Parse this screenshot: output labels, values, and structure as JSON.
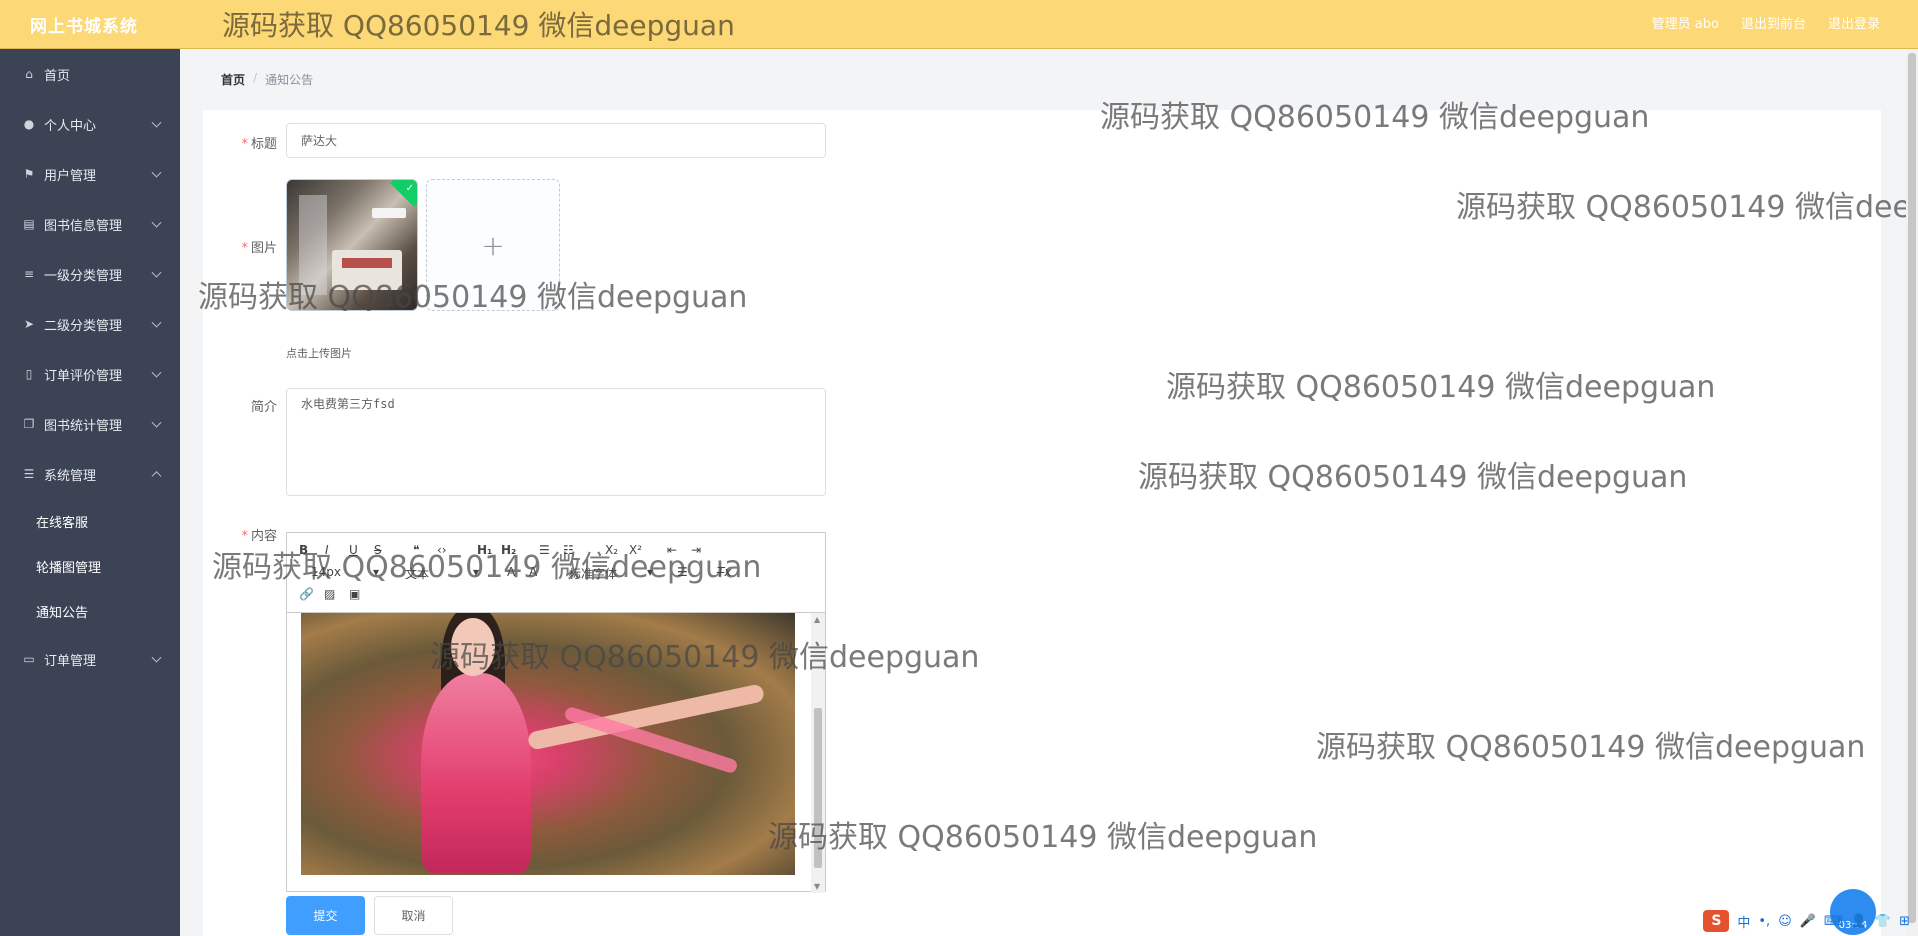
{
  "header": {
    "logo": "网上书城系统",
    "watermark": "源码获取 QQ86050149 微信deepguan",
    "admin_label": "管理员 abo",
    "back_label": "退出到前台",
    "logout_label": "退出登录"
  },
  "sidebar": {
    "items": [
      {
        "label": "首页",
        "icon": "home-icon"
      },
      {
        "label": "个人中心",
        "icon": "user-icon"
      },
      {
        "label": "用户管理",
        "icon": "flag-icon"
      },
      {
        "label": "图书信息管理",
        "icon": "book-icon"
      },
      {
        "label": "一级分类管理",
        "icon": "list-icon"
      },
      {
        "label": "二级分类管理",
        "icon": "send-icon"
      },
      {
        "label": "订单评价管理",
        "icon": "mobile-icon"
      },
      {
        "label": "图书统计管理",
        "icon": "copy-icon"
      },
      {
        "label": "系统管理",
        "icon": "sliders-icon"
      },
      {
        "label": "订单管理",
        "icon": "message-icon"
      }
    ],
    "sub_items": [
      "在线客服",
      "轮播图管理",
      "通知公告"
    ]
  },
  "breadcrumb": {
    "home": "首页",
    "separator": "/",
    "current": "通知公告"
  },
  "form": {
    "title_label": "标题",
    "title_value": "萨达大",
    "image_label": "图片",
    "upload_plus": "+",
    "upload_tip": "点击上传图片",
    "intro_label": "简介",
    "intro_value": "水电费第三方fsd",
    "content_label": "内容",
    "submit_label": "提交",
    "cancel_label": "取消"
  },
  "editor": {
    "font_size": "14px",
    "font_type": "文本",
    "font_family": "标准字体"
  },
  "watermark_text": "源码获取 QQ86050149 微信deepguan",
  "clock": "03:54",
  "ime": {
    "logo": "S",
    "lang": "中"
  }
}
